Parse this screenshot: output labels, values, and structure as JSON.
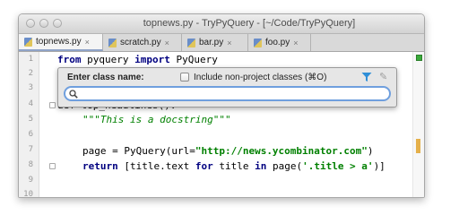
{
  "window": {
    "title": "topnews.py - TryPyQuery - [~/Code/TryPyQuery]"
  },
  "tabs": [
    {
      "label": "topnews.py",
      "close": "×",
      "active": true
    },
    {
      "label": "scratch.py",
      "close": "×",
      "active": false
    },
    {
      "label": "bar.py",
      "close": "×",
      "active": false
    },
    {
      "label": "foo.py",
      "close": "×",
      "active": false
    }
  ],
  "editor": {
    "line_numbers": [
      "1",
      "2",
      "3",
      "4",
      "5",
      "6",
      "7",
      "8",
      "9",
      "10"
    ],
    "line1": {
      "kw1": "from",
      "mod": " pyquery ",
      "kw2": "import",
      "name": " PyQuery"
    },
    "line4": {
      "text": "def top_headlines():"
    },
    "line5": {
      "text": "\"\"\"This is a docstring\"\"\""
    },
    "line7": {
      "pre": "page = PyQuery(url=",
      "str": "\"http://news.ycombinator.com\"",
      "post": ")"
    },
    "line8": {
      "kw": "return",
      "mid": " [title.text ",
      "kw2": "for",
      "mid2": " title ",
      "kw3": "in",
      "pre_str": " page(",
      "str": "'.title > a'",
      "post": ")]"
    }
  },
  "popup": {
    "label": "Enter class name:",
    "checkbox_label": "Include non-project classes (⌘O)",
    "checkbox_checked": false,
    "search_value": "",
    "filter_icon": "filter-icon",
    "pin_icon": "pin-icon"
  },
  "colors": {
    "keyword": "#000080",
    "string": "#008000",
    "search_focus": "#6f9fde"
  }
}
